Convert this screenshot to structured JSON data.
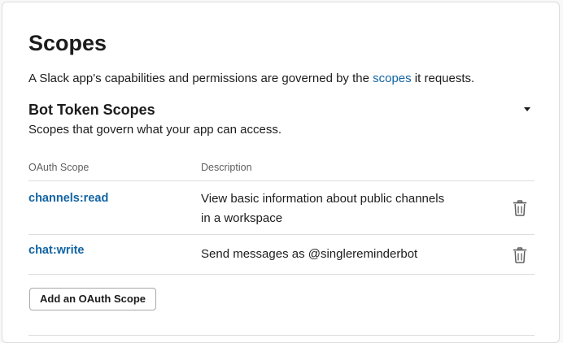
{
  "page": {
    "title": "Scopes",
    "intro_before": "A Slack app's capabilities and permissions are governed by the ",
    "intro_link": "scopes",
    "intro_after": " it requests."
  },
  "section": {
    "title": "Bot Token Scopes",
    "description": "Scopes that govern what your app can access."
  },
  "table": {
    "headers": {
      "scope": "OAuth Scope",
      "description": "Description"
    },
    "rows": [
      {
        "scope": "channels:read",
        "description_line1": "View basic information about public channels",
        "description_line2": "in a workspace"
      },
      {
        "scope": "chat:write",
        "description_line1": "Send messages as @singlereminderbot"
      }
    ]
  },
  "actions": {
    "add_scope_label": "Add an OAuth Scope"
  },
  "icons": {
    "collapse": "caret-down-icon",
    "delete": "trash-icon"
  },
  "colors": {
    "link": "#1264a3",
    "text": "#1d1c1d",
    "muted": "#616061",
    "border": "#dddddd"
  }
}
